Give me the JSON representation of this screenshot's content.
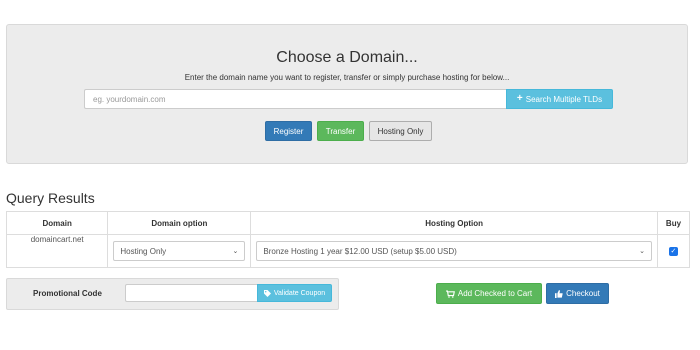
{
  "domain_panel": {
    "title": "Choose a Domain...",
    "subtitle": "Enter the domain name you want to register, transfer or simply purchase hosting for below...",
    "input_placeholder": "eg. yourdomain.com",
    "search_tlds_label": "Search Multiple TLDs",
    "search_tlds_icon": "plus-icon",
    "register_label": "Register",
    "transfer_label": "Transfer",
    "hosting_only_label": "Hosting Only"
  },
  "results": {
    "title": "Query Results",
    "columns": [
      "Domain",
      "Domain option",
      "Hosting Option",
      "Buy"
    ],
    "rows": [
      {
        "domain": "domaincart.net",
        "domain_option": "Hosting Only",
        "hosting_option": "Bronze Hosting 1 year $12.00 USD (setup $5.00 USD)",
        "buy_checked": true
      }
    ]
  },
  "promo": {
    "label": "Promotional Code",
    "input_value": "",
    "validate_label": "Validate Coupon",
    "validate_icon": "tag-icon"
  },
  "actions": {
    "add_to_cart_label": "Add Checked to Cart",
    "add_to_cart_icon": "cart-icon",
    "checkout_label": "Checkout",
    "checkout_icon": "thumbs-up-icon"
  },
  "colors": {
    "primary": "#337ab7",
    "success": "#5cb85c",
    "info": "#5bc0de",
    "panel": "#ececec"
  }
}
